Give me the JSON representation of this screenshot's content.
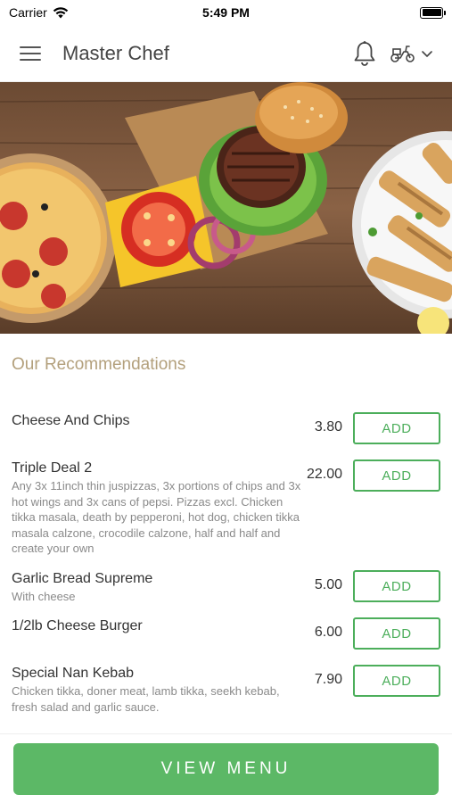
{
  "status_bar": {
    "carrier": "Carrier",
    "time": "5:49 PM"
  },
  "header": {
    "title": "Master Chef",
    "icons": [
      "menu-icon",
      "bell-icon",
      "scooter-icon",
      "chevron-down-icon"
    ]
  },
  "recommendations": {
    "title": "Our Recommendations",
    "add_label": "ADD",
    "items": [
      {
        "name": "Cheese And Chips",
        "description": "",
        "price": "3.80"
      },
      {
        "name": "Triple Deal 2",
        "description": "Any 3x 11inch thin juspizzas, 3x portions of chips and 3x hot wings and 3x cans of pepsi. Pizzas excl. Chicken tikka masala, death by pepperoni, hot dog, chicken tikka masala calzone, crocodile calzone, half and half and create your own",
        "price": "22.00"
      },
      {
        "name": "Garlic Bread Supreme",
        "description": "With cheese",
        "price": "5.00"
      },
      {
        "name": "1/2lb Cheese Burger",
        "description": "",
        "price": "6.00"
      },
      {
        "name": "Special Nan Kebab",
        "description": "Chicken tikka, doner meat, lamb tikka, seekh kebab, fresh salad and garlic sauce.",
        "price": "7.90"
      }
    ]
  },
  "footer": {
    "view_menu_label": "VIEW MENU"
  },
  "colors": {
    "accent_green": "#5cb866",
    "section_title": "#b3a07c"
  }
}
